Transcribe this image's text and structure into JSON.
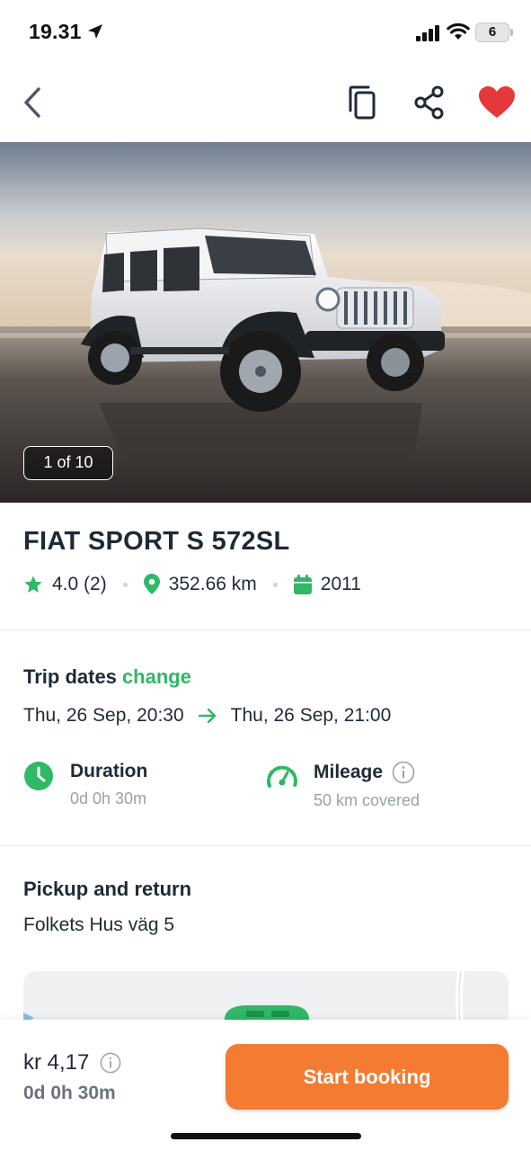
{
  "status_bar": {
    "time": "19.31",
    "battery": "6"
  },
  "hero": {
    "photo_counter": "1 of 10"
  },
  "car": {
    "title": "FIAT SPORT S 572SL",
    "rating": "4.0 (2)",
    "distance": "352.66 km",
    "year": "2011"
  },
  "trip": {
    "title": "Trip dates",
    "change_label": "change",
    "start": "Thu, 26 Sep, 20:30",
    "end": "Thu, 26 Sep, 21:00",
    "duration_label": "Duration",
    "duration_value": "0d 0h 30m",
    "mileage_label": "Mileage",
    "mileage_value": "50 km covered"
  },
  "pickup": {
    "title": "Pickup and return",
    "address": "Folkets Hus väg 5"
  },
  "booking": {
    "price": "kr 4,17",
    "duration": "0d 0h 30m",
    "button_label": "Start booking"
  },
  "colors": {
    "accent_green": "#2fb866",
    "cta_orange": "#f47b32",
    "favorite_red": "#e5383b",
    "text_dark": "#1f2a37",
    "text_muted": "#9aa1a9"
  },
  "icons": [
    "location-arrow-icon",
    "signal-icon",
    "wifi-icon",
    "back-chevron-icon",
    "copy-icon",
    "share-icon",
    "heart-icon",
    "star-icon",
    "map-pin-icon",
    "calendar-icon",
    "arrow-right-icon",
    "clock-icon",
    "speedometer-icon",
    "info-icon",
    "car-marker-icon"
  ]
}
